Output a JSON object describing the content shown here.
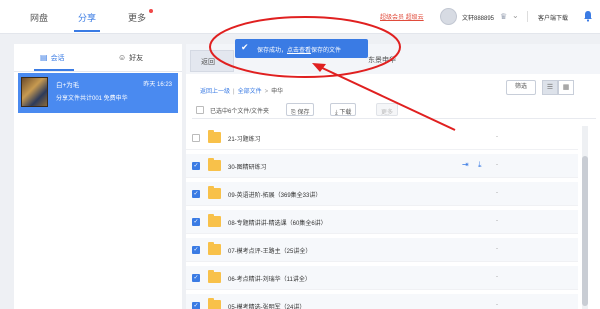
{
  "nav": {
    "items": [
      "网盘",
      "分享",
      "更多"
    ],
    "active": 1
  },
  "header": {
    "promo": "超级会员 超级云",
    "user_name": "文轩888895",
    "vip_icon": "crown-icon",
    "client_download": "客户端下载",
    "bell_icon": "bell-icon"
  },
  "sidebar": {
    "tabs": [
      {
        "label": "会话",
        "icon": "chat-icon"
      },
      {
        "label": "好友",
        "icon": "friend-icon"
      }
    ],
    "conversation": {
      "name": "白+为毛",
      "time": "昨天 16:23",
      "message": "分享文件共计001 免费申华"
    }
  },
  "main": {
    "tab": "返回",
    "tab_trail": "东景申华",
    "toast": {
      "prefix": "保存成功，",
      "link": "点击查看",
      "suffix": "保存的文件"
    },
    "breadcrumb": {
      "back": "返回上一级",
      "all": "全部文件",
      "current": "申华"
    },
    "filter_label": "筛选",
    "selection": {
      "text": "已选中6个文件/文件夹",
      "save": "保存",
      "download": "下载",
      "more": "更多"
    },
    "files": [
      {
        "name": "21-习题练习",
        "selected": false,
        "size": "-"
      },
      {
        "name": "30-图精研练习",
        "selected": true,
        "size": "-"
      },
      {
        "name": "09-英语进阶-拓展（369集全33讲）",
        "selected": true,
        "size": "-"
      },
      {
        "name": "08-专题精讲讲-精选课（60集全6讲）",
        "selected": true,
        "size": "-"
      },
      {
        "name": "07-模考点评-王路主（25讲全）",
        "selected": true,
        "size": "-"
      },
      {
        "name": "06-考点精讲-刘瑞华（11讲全）",
        "selected": true,
        "size": "-"
      },
      {
        "name": "05-模考精选-张明军（24讲）",
        "selected": true,
        "size": "-"
      }
    ]
  }
}
